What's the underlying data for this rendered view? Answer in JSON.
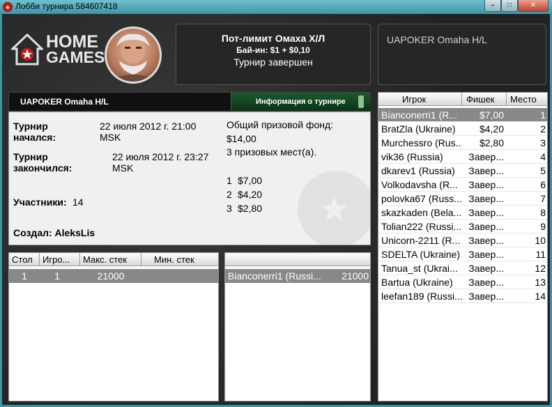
{
  "window": {
    "title": "Лобби турнира 584607418",
    "controls": {
      "minimize": "–",
      "maximize": "□",
      "close": "✕"
    }
  },
  "logo": {
    "line1": "HOME",
    "line2": "GAMES"
  },
  "header": {
    "game": "Пот-лимит Омаха Х/Л",
    "buyin": "Бай-ин: $1 + $0,10",
    "status": "Турнир завершен"
  },
  "club_name": "UAPOKER Omaha H/L",
  "info": {
    "bar_name": "UAPOKER Omaha H/L",
    "tab_label": "Информация о турнире",
    "started_label": "Турнир начался:",
    "started_value": "22 июля 2012 г. 21:00 MSK",
    "ended_label": "Турнир закончился:",
    "ended_value": "22 июля 2012 г. 23:27 MSK",
    "participants_label": "Участники:",
    "participants_value": "14",
    "creator": "Создал: AleksLis",
    "prize_pool_label": "Общий призовой фонд:",
    "prize_pool_value": "$14,00",
    "paid_places": "3 призовых мест(а).",
    "prizes": [
      {
        "place": "1",
        "amount": "$7,00"
      },
      {
        "place": "2",
        "amount": "$4,20"
      },
      {
        "place": "3",
        "amount": "$2,80"
      }
    ]
  },
  "tables": {
    "headers": [
      "Стол",
      "Игро...",
      "Макс. стек",
      "Мин. стек"
    ],
    "rows": [
      [
        "1",
        "1",
        "21000",
        ""
      ]
    ]
  },
  "table_players": {
    "rows": [
      [
        "Bianconerri1 (Russi...",
        "21000"
      ]
    ]
  },
  "players": {
    "headers": [
      "Игрок",
      "Фишек",
      "Место"
    ],
    "rows": [
      [
        "Bianconerri1 (R...",
        "$7,00",
        "1"
      ],
      [
        "BratZla (Ukraine)",
        "$4,20",
        "2"
      ],
      [
        "Murchessro (Rus...",
        "$2,80",
        "3"
      ],
      [
        "vik36 (Russia)",
        "Завер...",
        "4"
      ],
      [
        "dkarev1 (Russia)",
        "Завер...",
        "5"
      ],
      [
        "Volkodavsha (R...",
        "Завер...",
        "6"
      ],
      [
        "polovka67 (Russ...",
        "Завер...",
        "7"
      ],
      [
        "skazkaden (Bela...",
        "Завер...",
        "8"
      ],
      [
        "Tolian222 (Russi...",
        "Завер...",
        "9"
      ],
      [
        "Unicorn-2211 (R...",
        "Завер...",
        "10"
      ],
      [
        "SDELTA (Ukraine)",
        "Завер...",
        "11"
      ],
      [
        "Tanua_st (Ukrai...",
        "Завер...",
        "12"
      ],
      [
        "Bartua (Ukraine)",
        "Завер...",
        "13"
      ],
      [
        "leefan189 (Russi...",
        "Завер...",
        "14"
      ]
    ]
  }
}
